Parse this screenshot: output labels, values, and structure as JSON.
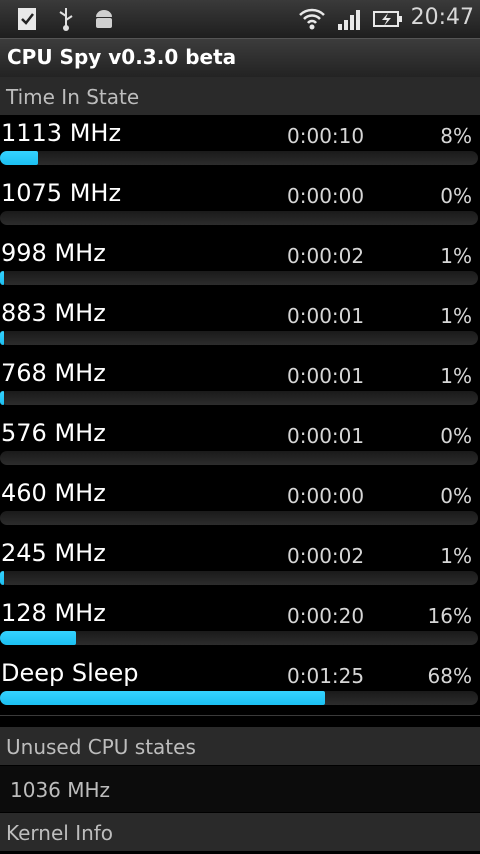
{
  "status_bar": {
    "time": "20:47",
    "icons": [
      "checklist-icon",
      "usb-icon",
      "android-icon",
      "wifi-icon",
      "signal-icon",
      "battery-charging-icon"
    ]
  },
  "app": {
    "title": "CPU Spy v0.3.0 beta"
  },
  "sections": {
    "time_in_state": "Time In State",
    "unused": "Unused CPU states",
    "kernel": "Kernel Info"
  },
  "states": [
    {
      "freq": "1113 MHz",
      "time": "0:00:10",
      "pct": "8%",
      "fill": 8
    },
    {
      "freq": "1075 MHz",
      "time": "0:00:00",
      "pct": "0%",
      "fill": 0
    },
    {
      "freq": "998 MHz",
      "time": "0:00:02",
      "pct": "1%",
      "fill": 1
    },
    {
      "freq": "883 MHz",
      "time": "0:00:01",
      "pct": "1%",
      "fill": 1
    },
    {
      "freq": "768 MHz",
      "time": "0:00:01",
      "pct": "1%",
      "fill": 1
    },
    {
      "freq": "576 MHz",
      "time": "0:00:01",
      "pct": "0%",
      "fill": 0
    },
    {
      "freq": "460 MHz",
      "time": "0:00:00",
      "pct": "0%",
      "fill": 0
    },
    {
      "freq": "245 MHz",
      "time": "0:00:02",
      "pct": "1%",
      "fill": 1
    },
    {
      "freq": "128 MHz",
      "time": "0:00:20",
      "pct": "16%",
      "fill": 16
    },
    {
      "freq": "Deep Sleep",
      "time": "0:01:25",
      "pct": "68%",
      "fill": 68
    }
  ],
  "unused_states": [
    "1036 MHz"
  ],
  "colors": {
    "accent": "#1cc0f2",
    "background": "#000000",
    "header": "#2a2a2a"
  }
}
